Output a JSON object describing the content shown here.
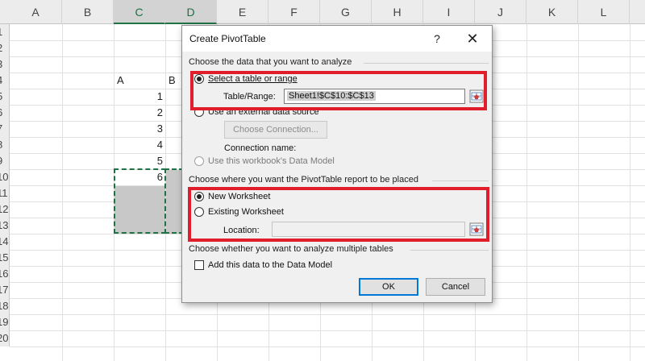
{
  "sheet": {
    "columns": [
      "A",
      "B",
      "C",
      "D",
      "E",
      "F",
      "G",
      "H",
      "I",
      "J",
      "K",
      "L"
    ],
    "rows": [
      "1",
      "2",
      "3",
      "4",
      "5",
      "6",
      "7",
      "8",
      "9",
      "10",
      "11",
      "12",
      "13",
      "14",
      "15",
      "16",
      "17",
      "18",
      "19",
      "20"
    ],
    "cells": {
      "c4": "A",
      "d4": "B",
      "c5": "1",
      "c6": "2",
      "c7": "3",
      "c8": "4",
      "c9": "5",
      "c10": "6"
    }
  },
  "dialog": {
    "title": "Create PivotTable",
    "help_glyph": "?",
    "close_glyph": "✕",
    "choose_data_label": "Choose the data that you want to analyze",
    "select_table_option": "Select a table or range",
    "table_range_label": "Table/Range:",
    "table_range_value": "Sheet1!$C$10:$C$13",
    "external_source_option": "Use an external data source",
    "choose_connection_button": "Choose Connection...",
    "connection_name_label": "Connection name:",
    "data_model_option": "Use this workbook's Data Model",
    "placement_label": "Choose where you want the PivotTable report to be placed",
    "new_worksheet_option": "New Worksheet",
    "existing_worksheet_option": "Existing Worksheet",
    "location_label": "Location:",
    "location_value": "",
    "multiple_tables_label": "Choose whether you want to analyze multiple tables",
    "add_to_model_label": "Add this data to the Data Model",
    "ok_button": "OK",
    "cancel_button": "Cancel",
    "selected_data_option": "Select a table or range",
    "selected_placement_option": "New Worksheet",
    "add_to_model_checked": false
  },
  "colors": {
    "highlight": "#e01e2b",
    "selection_green": "#217346",
    "focus_blue": "#0078d7"
  },
  "icons": [
    "help-icon",
    "close-icon",
    "range-collapse-icon"
  ]
}
